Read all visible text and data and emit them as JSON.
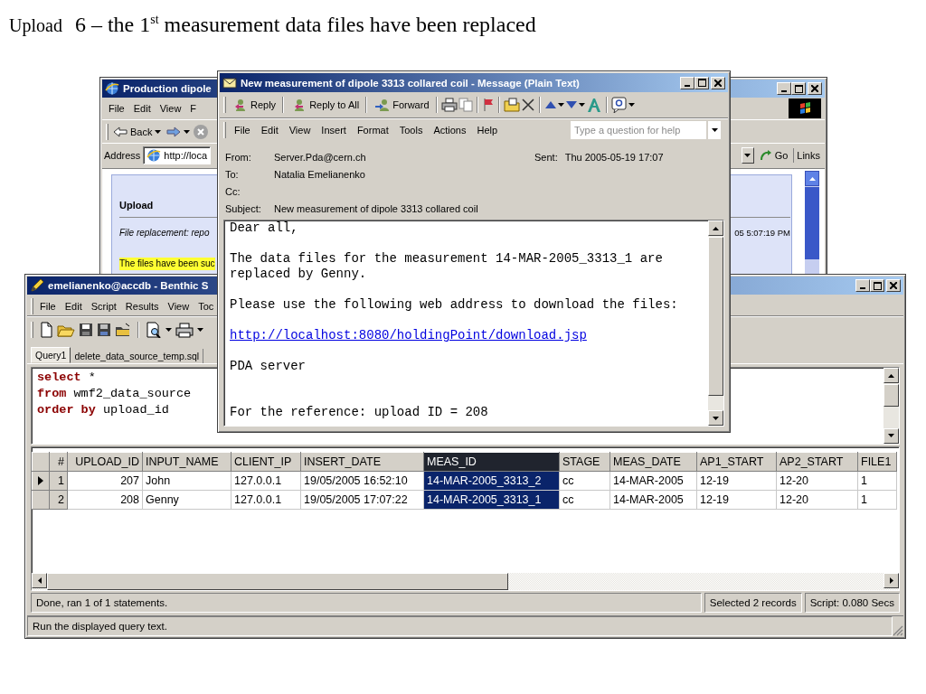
{
  "slide": {
    "section": "Upload",
    "title": "6 – the 1$^{st}$ measurement data files have been replaced"
  },
  "browser_window": {
    "title": "Production dipole",
    "menu": [
      "File",
      "Edit",
      "View",
      "F"
    ],
    "back_label": "Back",
    "address_label": "Address",
    "address": "http://loca",
    "go_label": "Go",
    "links_label": "Links",
    "page": {
      "heading": "Upload",
      "subtitle": "File replacement: repo",
      "time": "05 5:07:19 PM",
      "notice": "The files have been suc"
    }
  },
  "sql_window": {
    "title": "emelianenko@accdb - Benthic S",
    "menu": [
      "File",
      "Edit",
      "Script",
      "Results",
      "View",
      "Toc"
    ],
    "tabs": [
      {
        "label": "Query1",
        "selected": true
      },
      {
        "label": "delete_data_source_temp.sql",
        "selected": false
      }
    ],
    "sql": [
      [
        {
          "kind": "keyword",
          "text": "select"
        },
        {
          "kind": "plain",
          "text": "*"
        }
      ],
      [
        {
          "kind": "keyword",
          "text": "from"
        },
        {
          "kind": "plain",
          "text": "wmf2_data_source"
        }
      ],
      [
        {
          "kind": "keyword",
          "text": "order by"
        },
        {
          "kind": "plain",
          "text": "upload_id"
        }
      ]
    ],
    "grid": {
      "columns": [
        {
          "label": "#",
          "kind": "number",
          "selected": false
        },
        {
          "label": "UPLOAD_ID",
          "kind": "number",
          "selected": false
        },
        {
          "label": "INPUT_NAME",
          "kind": "text",
          "selected": false
        },
        {
          "label": "CLIENT_IP",
          "kind": "text",
          "selected": false
        },
        {
          "label": "INSERT_DATE",
          "kind": "text",
          "selected": false
        },
        {
          "label": "MEAS_ID",
          "kind": "text",
          "selected": true
        },
        {
          "label": "STAGE",
          "kind": "text",
          "selected": false
        },
        {
          "label": "MEAS_DATE",
          "kind": "text",
          "selected": false
        },
        {
          "label": "AP1_START",
          "kind": "text",
          "selected": false
        },
        {
          "label": "AP2_START",
          "kind": "text",
          "selected": false
        },
        {
          "label": "FILE1",
          "kind": "text",
          "selected": false
        }
      ],
      "rows": [
        {
          "current": true,
          "cells": [
            "1",
            "207",
            "John",
            "127.0.0.1",
            "19/05/2005 16:52:10",
            "14-MAR-2005_3313_2",
            "cc",
            "14-MAR-2005",
            "12-19",
            "12-20",
            "1"
          ]
        },
        {
          "current": false,
          "cells": [
            "2",
            "208",
            "Genny",
            "127.0.0.1",
            "19/05/2005 17:07:22",
            "14-MAR-2005_3313_1",
            "cc",
            "14-MAR-2005",
            "12-19",
            "12-20",
            "1"
          ]
        }
      ]
    },
    "status": [
      "Done, ran 1 of 1 statements.",
      "Selected 2 records",
      "Script: 0.080 Secs"
    ],
    "hint": "Run the displayed query text."
  },
  "message_window": {
    "title": "New measurement of dipole 3313 collared coil - Message (Plain Text)",
    "toolbar": [
      "Reply",
      "Reply to All",
      "Forward"
    ],
    "menu": [
      "File",
      "Edit",
      "View",
      "Insert",
      "Format",
      "Tools",
      "Actions",
      "Help"
    ],
    "help_placeholder": "Type a question for help",
    "headers": [
      {
        "label": "From:",
        "value": "Server.Pda@cern.ch"
      },
      {
        "label": "To:",
        "value": "Natalia Emelianenko"
      },
      {
        "label": "Cc:"
      },
      {
        "label": "Subject:",
        "value": "New measurement of dipole 3313 collared coil"
      }
    ],
    "sent_label": "Sent:",
    "sent": "Thu 2005-05-19 17:07",
    "body": [
      {
        "kind": "text",
        "text": "Dear all,"
      },
      {
        "kind": "text",
        "text": "The data files for the measurement 14-MAR-2005_3313_1 are replaced by Genny."
      },
      {
        "kind": "text",
        "text": "Please use the following web address to download the files:"
      },
      {
        "kind": "link",
        "text": "http://localhost:8080/holdingPoint/download.jsp"
      },
      {
        "kind": "text",
        "text": "PDA server"
      },
      {
        "kind": "footer",
        "text": "For the reference: upload ID = 208"
      }
    ]
  }
}
